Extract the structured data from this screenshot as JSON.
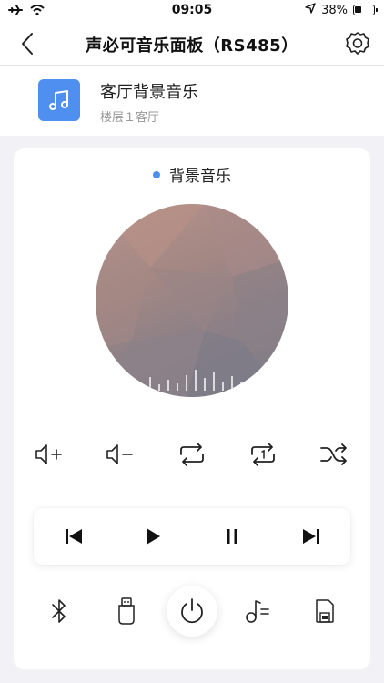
{
  "status_bar": {
    "time": "09:05",
    "battery": "38%",
    "icons": [
      "airplane-icon",
      "wifi-icon",
      "location-arrow-icon",
      "battery-icon"
    ]
  },
  "nav": {
    "title": "声必可音乐面板（RS485）",
    "back_icon": "chevron-left-icon",
    "settings_icon": "gear-icon"
  },
  "device": {
    "name": "客厅背景音乐",
    "location": "楼层１客厅",
    "icon": "music-note-icon",
    "icon_color": "#4f8ff0"
  },
  "player": {
    "mode_label": "背景音乐",
    "mode_dot_color": "#4f8ff0",
    "album_art": "low-poly-gradient-disc",
    "controls": [
      "volume-up-icon",
      "volume-down-icon",
      "repeat-icon",
      "repeat-one-icon",
      "shuffle-icon"
    ],
    "playback": [
      "previous-icon",
      "play-icon",
      "pause-icon",
      "next-icon"
    ],
    "sources": [
      "bluetooth-icon",
      "usb-icon",
      "power-icon",
      "music-list-icon",
      "sd-card-icon"
    ]
  }
}
